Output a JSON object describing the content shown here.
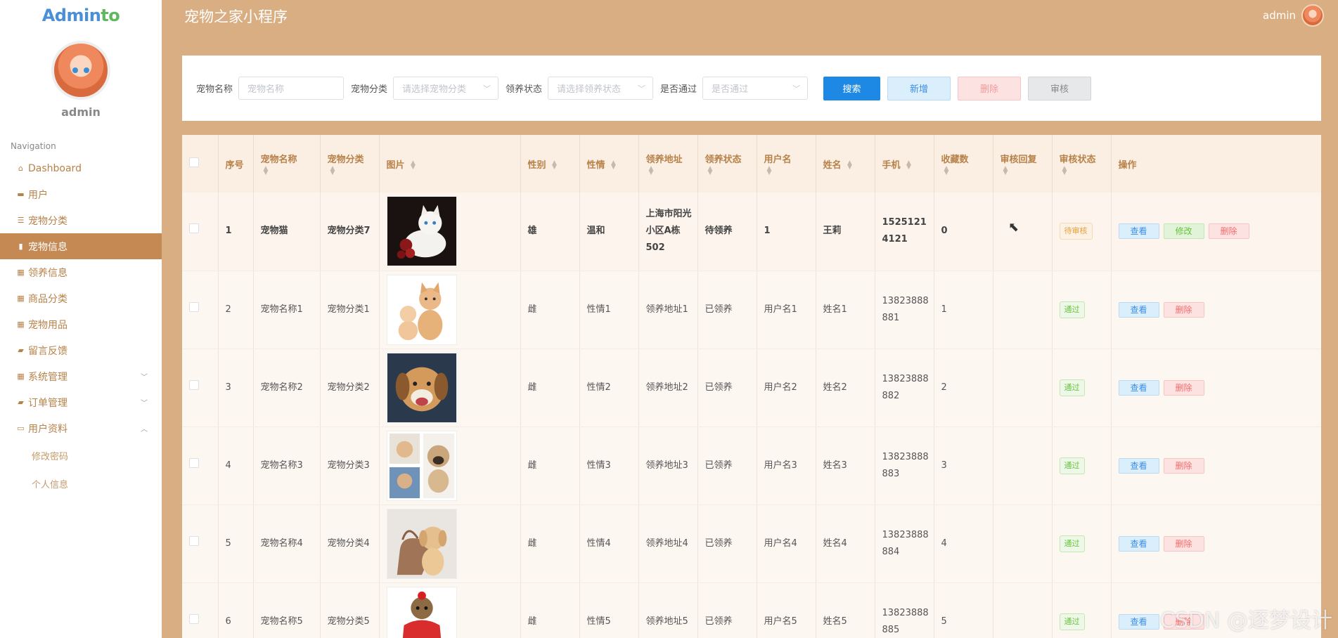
{
  "brand": {
    "name_a": "Admin",
    "name_b": "to"
  },
  "profile": {
    "name": "admin"
  },
  "nav": {
    "title": "Navigation",
    "items": [
      {
        "label": "Dashboard",
        "icon": "home-icon"
      },
      {
        "label": "用户",
        "icon": "comment-icon"
      },
      {
        "label": "宠物分类",
        "icon": "list-icon"
      },
      {
        "label": "宠物信息",
        "icon": "chart-icon",
        "active": true
      },
      {
        "label": "领养信息",
        "icon": "grid-icon"
      },
      {
        "label": "商品分类",
        "icon": "grid-icon"
      },
      {
        "label": "宠物用品",
        "icon": "grid-icon"
      },
      {
        "label": "留言反馈",
        "icon": "briefcase-icon"
      },
      {
        "label": "系统管理",
        "icon": "grid-icon",
        "chevron": "down"
      },
      {
        "label": "订单管理",
        "icon": "print-icon",
        "chevron": "down"
      },
      {
        "label": "用户资料",
        "icon": "card-icon",
        "chevron": "up"
      }
    ],
    "sub_items": [
      "修改密码",
      "个人信息"
    ]
  },
  "header": {
    "title": "宠物之家小程序",
    "user": "admin"
  },
  "search": {
    "pet_name_label": "宠物名称",
    "pet_name_placeholder": "宠物名称",
    "category_label": "宠物分类",
    "category_placeholder": "请选择宠物分类",
    "adopt_status_label": "领养状态",
    "adopt_status_placeholder": "请选择领养状态",
    "pass_label": "是否通过",
    "pass_placeholder": "是否通过",
    "btn_search": "搜索",
    "btn_add": "新增",
    "btn_delete": "删除",
    "btn_audit": "审核"
  },
  "table": {
    "columns": [
      "序号",
      "宠物名称",
      "宠物分类",
      "图片",
      "性别",
      "性情",
      "领养地址",
      "领养状态",
      "用户名",
      "姓名",
      "手机",
      "收藏数",
      "审核回复",
      "审核状态",
      "操作"
    ],
    "op_view": "查看",
    "op_edit": "修改",
    "op_delete": "删除",
    "rows": [
      {
        "no": "1",
        "name": "宠物猫",
        "category": "宠物分类7",
        "gender": "雄",
        "temper": "温和",
        "address": "上海市阳光小区A栋502",
        "adopt": "待领养",
        "username": "1",
        "realname": "王莉",
        "phone": "15251214121",
        "fav": "0",
        "reply": "",
        "status": "待审核"
      },
      {
        "no": "2",
        "name": "宠物名称1",
        "category": "宠物分类1",
        "gender": "雌",
        "temper": "性情1",
        "address": "领养地址1",
        "adopt": "已领养",
        "username": "用户名1",
        "realname": "姓名1",
        "phone": "13823888881",
        "fav": "1",
        "reply": "",
        "status": "通过"
      },
      {
        "no": "3",
        "name": "宠物名称2",
        "category": "宠物分类2",
        "gender": "雌",
        "temper": "性情2",
        "address": "领养地址2",
        "adopt": "已领养",
        "username": "用户名2",
        "realname": "姓名2",
        "phone": "13823888882",
        "fav": "2",
        "reply": "",
        "status": "通过"
      },
      {
        "no": "4",
        "name": "宠物名称3",
        "category": "宠物分类3",
        "gender": "雌",
        "temper": "性情3",
        "address": "领养地址3",
        "adopt": "已领养",
        "username": "用户名3",
        "realname": "姓名3",
        "phone": "13823888883",
        "fav": "3",
        "reply": "",
        "status": "通过"
      },
      {
        "no": "5",
        "name": "宠物名称4",
        "category": "宠物分类4",
        "gender": "雌",
        "temper": "性情4",
        "address": "领养地址4",
        "adopt": "已领养",
        "username": "用户名4",
        "realname": "姓名4",
        "phone": "13823888884",
        "fav": "4",
        "reply": "",
        "status": "通过"
      },
      {
        "no": "6",
        "name": "宠物名称5",
        "category": "宠物分类5",
        "gender": "雌",
        "temper": "性情5",
        "address": "领养地址5",
        "adopt": "已领养",
        "username": "用户名5",
        "realname": "姓名5",
        "phone": "13823888885",
        "fav": "5",
        "reply": "",
        "status": "通过"
      }
    ]
  },
  "watermark": "CSDN @逐梦设计"
}
